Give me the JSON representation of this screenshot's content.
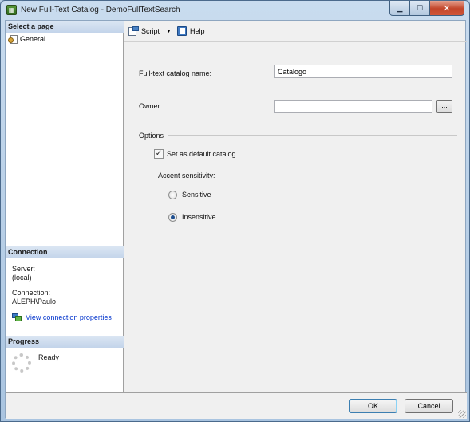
{
  "window": {
    "title": "New Full-Text Catalog - DemoFullTextSearch",
    "icon": "sql-catalog-icon"
  },
  "left_pane": {
    "select_page_header": "Select a page",
    "pages": [
      {
        "label": "General",
        "icon": "gear-page-icon",
        "selected": true
      }
    ],
    "connection_header": "Connection",
    "server_label": "Server:",
    "server_value": "(local)",
    "connection_label": "Connection:",
    "connection_value": "ALEPH\\Paulo",
    "view_connection_link": "View connection properties",
    "progress_header": "Progress",
    "progress_status": "Ready"
  },
  "toolbar": {
    "script_label": "Script",
    "help_label": "Help"
  },
  "form": {
    "catalog_name_label": "Full-text catalog name:",
    "catalog_name_value": "Catalogo",
    "owner_label": "Owner:",
    "owner_value": "",
    "browse_label": "...",
    "options_label": "Options",
    "default_catalog_label": "Set as default catalog",
    "default_catalog_checked": true,
    "accent_label": "Accent sensitivity:",
    "sensitive_label": "Sensitive",
    "insensitive_label": "Insensitive",
    "accent_selected": "Insensitive"
  },
  "buttons": {
    "ok": "OK",
    "cancel": "Cancel"
  },
  "colors": {
    "link": "#0033cc",
    "header_bg": "#c3d4ea",
    "close_button": "#c2452a"
  }
}
